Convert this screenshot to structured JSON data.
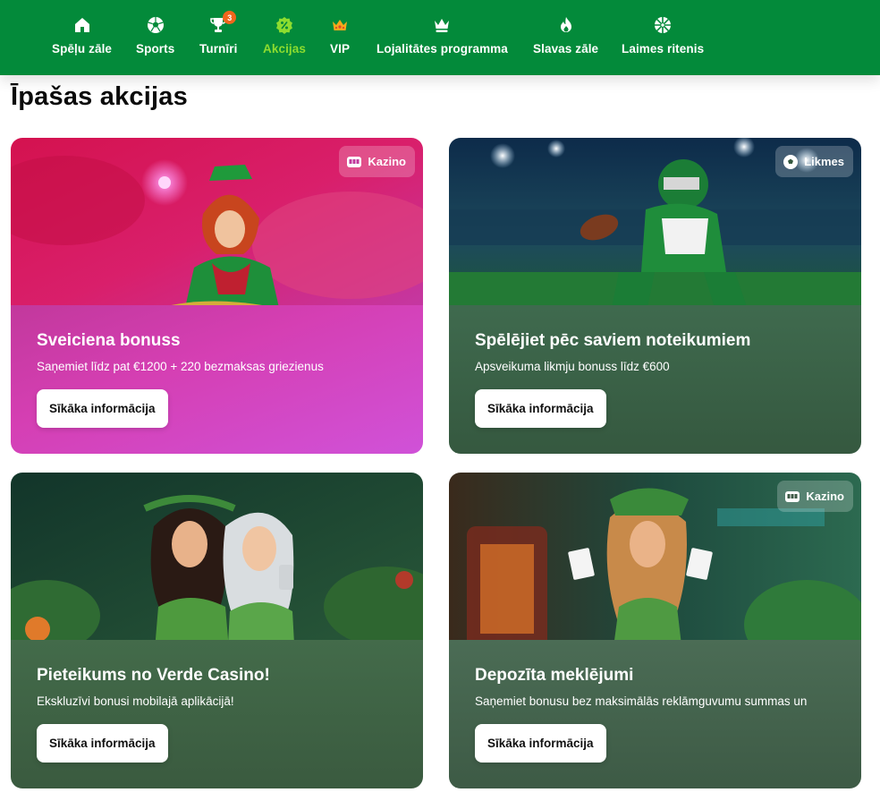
{
  "nav": {
    "items": [
      {
        "label": "Spēļu zāle",
        "icon": "home-icon"
      },
      {
        "label": "Sports",
        "icon": "soccer-ball-icon"
      },
      {
        "label": "Turnīri",
        "icon": "trophy-icon",
        "badge": "3"
      },
      {
        "label": "Akcijas",
        "icon": "percent-badge-icon",
        "active": true
      },
      {
        "label": "VIP",
        "icon": "crown-icon"
      },
      {
        "label": "Lojalitātes programma",
        "icon": "crown-outline-icon"
      },
      {
        "label": "Slavas zāle",
        "icon": "flame-icon"
      },
      {
        "label": "Laimes ritenis",
        "icon": "wheel-icon"
      }
    ]
  },
  "page_title": "Īpašas akcijas",
  "cards": [
    {
      "title": "Sveiciena bonuss",
      "desc": "Saņemiet līdz pat €1200 + 220 bezmaksas griezienus",
      "button": "Sīkāka informācija",
      "tag": "Kazino",
      "tag_icon": "slot-machine-icon"
    },
    {
      "title": "Spēlējiet pēc saviem noteikumiem",
      "desc": "Apsveikuma likmju bonuss līdz €600",
      "button": "Sīkāka informācija",
      "tag": "Likmes",
      "tag_icon": "soccer-ball-icon"
    },
    {
      "title": "Pieteikums no Verde Casino!",
      "desc": "Ekskluzīvi bonusi mobilajā aplikācijā!",
      "button": "Sīkāka informācija"
    },
    {
      "title": "Depozīta meklējumi",
      "desc": "Saņemiet bonusu bez maksimālās reklāmguvumu summas un",
      "button": "Sīkāka informācija",
      "tag": "Kazino",
      "tag_icon": "slot-machine-icon"
    }
  ],
  "colors": {
    "nav_bg": "#038a3a",
    "nav_active": "#8ddc2f",
    "badge": "#f0661c"
  }
}
